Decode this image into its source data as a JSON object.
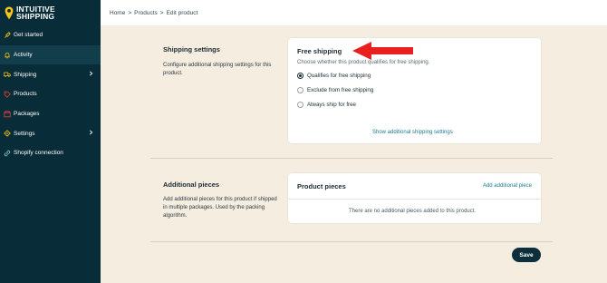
{
  "app": {
    "logo_line1": "INTUITIVE",
    "logo_line2": "SHIPPING"
  },
  "sidebar": {
    "items": [
      {
        "label": "Get started",
        "icon": "rocket-icon",
        "active": false,
        "chevron": false
      },
      {
        "label": "Activity",
        "icon": "bell-icon",
        "active": true,
        "chevron": false
      },
      {
        "label": "Shipping",
        "icon": "truck-icon",
        "active": false,
        "chevron": true
      },
      {
        "label": "Products",
        "icon": "tag-icon",
        "active": false,
        "chevron": false
      },
      {
        "label": "Packages",
        "icon": "box-icon",
        "active": false,
        "chevron": false
      },
      {
        "label": "Settings",
        "icon": "gear-icon",
        "active": false,
        "chevron": true
      },
      {
        "label": "Shopify connection",
        "icon": "link-icon",
        "active": false,
        "chevron": false
      }
    ]
  },
  "breadcrumb": [
    "Home",
    "Products",
    "Edit product"
  ],
  "shipping_settings": {
    "title": "Shipping settings",
    "description": "Configure additional shipping settings for this product."
  },
  "free_shipping": {
    "title": "Free shipping",
    "subtitle": "Choose whether this product qualifies for free shipping.",
    "options": [
      {
        "label": "Qualifies for free shipping",
        "checked": true
      },
      {
        "label": "Exclude from free shipping",
        "checked": false
      },
      {
        "label": "Always ship for free",
        "checked": false
      }
    ],
    "link": "Show additional shipping settings"
  },
  "additional_pieces": {
    "title": "Additional pieces",
    "description": "Add additional pieces for this product if shipped in multiple packages. Used by the packing algorithm."
  },
  "product_pieces": {
    "title": "Product pieces",
    "add_link": "Add additional piece",
    "empty": "There are no additional pieces added to this product."
  },
  "save_label": "Save",
  "colors": {
    "sidebar_bg": "#082c38",
    "page_bg": "#f4ede0",
    "link": "#1d7a94",
    "annotation_arrow": "#e8201f",
    "logo_yellow": "#f5c518"
  }
}
